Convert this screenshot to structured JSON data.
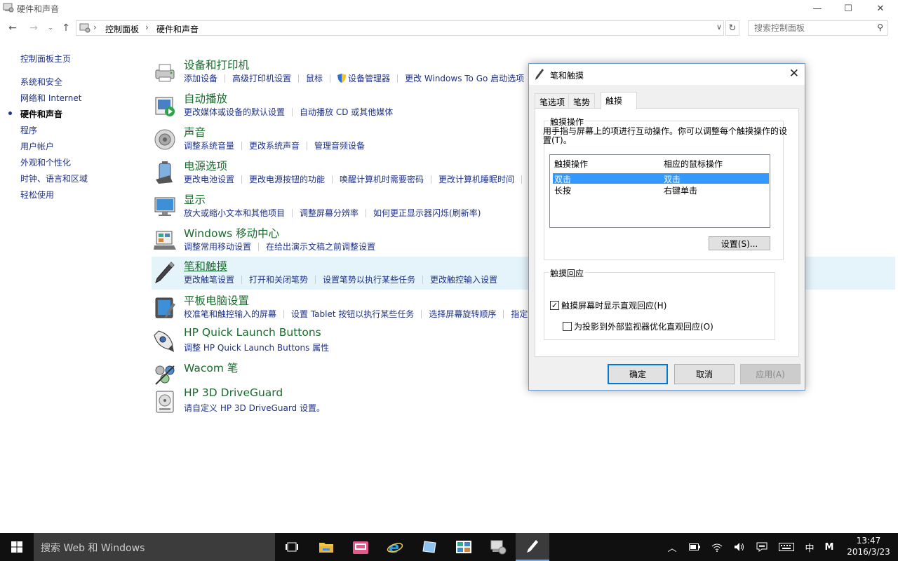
{
  "window": {
    "title": "硬件和声音",
    "controls": {
      "minimize": "—",
      "maximize": "☐",
      "close": "✕"
    }
  },
  "address": {
    "crumbs": [
      "控制面板",
      "硬件和声音"
    ],
    "search_placeholder": "搜索控制面板"
  },
  "leftnav": {
    "items": [
      "控制面板主页",
      "系统和安全",
      "网络和 Internet",
      "硬件和声音",
      "程序",
      "用户帐户",
      "外观和个性化",
      "时钟、语言和区域",
      "轻松使用"
    ]
  },
  "categories": [
    {
      "title": "设备和打印机",
      "icon": "printer-icon",
      "links": [
        "添加设备",
        "高级打印机设置",
        "鼠标",
        "设备管理器",
        "更改 Windows To Go 启动选项"
      ]
    },
    {
      "title": "自动播放",
      "icon": "autoplay-icon",
      "links": [
        "更改媒体或设备的默认设置",
        "自动播放 CD 或其他媒体"
      ]
    },
    {
      "title": "声音",
      "icon": "speaker-icon",
      "links": [
        "调整系统音量",
        "更改系统声音",
        "管理音频设备"
      ]
    },
    {
      "title": "电源选项",
      "icon": "power-icon",
      "links": [
        "更改电池设置",
        "更改电源按钮的功能",
        "唤醒计算机时需要密码",
        "更改计算机睡眠时间"
      ]
    },
    {
      "title": "显示",
      "icon": "monitor-icon",
      "links": [
        "放大或缩小文本和其他项目",
        "调整屏幕分辨率",
        "如何更正显示器闪烁(刷新率)"
      ]
    },
    {
      "title": "Windows 移动中心",
      "icon": "mobility-center-icon",
      "links": [
        "调整常用移动设置",
        "在给出演示文稿之前调整设置"
      ]
    },
    {
      "title": "笔和触摸",
      "icon": "pen-icon",
      "links": [
        "更改触笔设置",
        "打开和关闭笔势",
        "设置笔势以执行某些任务",
        "更改触控输入设置"
      ]
    },
    {
      "title": "平板电脑设置",
      "icon": "tablet-icon",
      "links": [
        "校准笔和触控输入的屏幕",
        "设置 Tablet 按钮以执行某些任务",
        "选择屏幕旋转顺序",
        "指定"
      ]
    },
    {
      "title": "HP Quick Launch Buttons",
      "icon": "rocket-icon",
      "links": [
        "调整 HP Quick Launch Buttons 属性"
      ]
    },
    {
      "title": "Wacom 笔",
      "icon": "wacom-icon",
      "links": []
    },
    {
      "title": "HP 3D DriveGuard",
      "icon": "driveguard-icon",
      "links": [
        "请自定义 HP 3D DriveGuard 设置。"
      ]
    }
  ],
  "dialog": {
    "title": "笔和触摸",
    "tabs": [
      "笔选项",
      "笔势",
      "触摸"
    ],
    "active_tab": 2,
    "touch_actions": {
      "group_label": "触摸操作",
      "description": "用手指与屏幕上的项进行互动操作。你可以调整每个触摸操作的设置(T)。",
      "columns": [
        "触摸操作",
        "相应的鼠标操作"
      ],
      "rows": [
        [
          "双击",
          "双击"
        ],
        [
          "长按",
          "右键单击"
        ]
      ],
      "selected_row": 0,
      "settings_button": "设置(S)..."
    },
    "feedback": {
      "group_label": "触摸回应",
      "checkbox1": {
        "label": "触摸屏幕时显示直观回应(H)",
        "checked": true
      },
      "checkbox2": {
        "label": "为投影到外部监视器优化直观回应(O)",
        "checked": false
      }
    },
    "buttons": {
      "ok": "确定",
      "cancel": "取消",
      "apply": "应用(A)"
    }
  },
  "taskbar": {
    "search_text": "搜索 Web 和 Windows",
    "time": "13:47",
    "date": "2016/3/23",
    "ime": "中",
    "ime_mode": "M"
  },
  "colors": {
    "link": "#1e3287",
    "category_title": "#1a6b2e",
    "selection": "#3399ff",
    "taskbar": "#101010"
  }
}
